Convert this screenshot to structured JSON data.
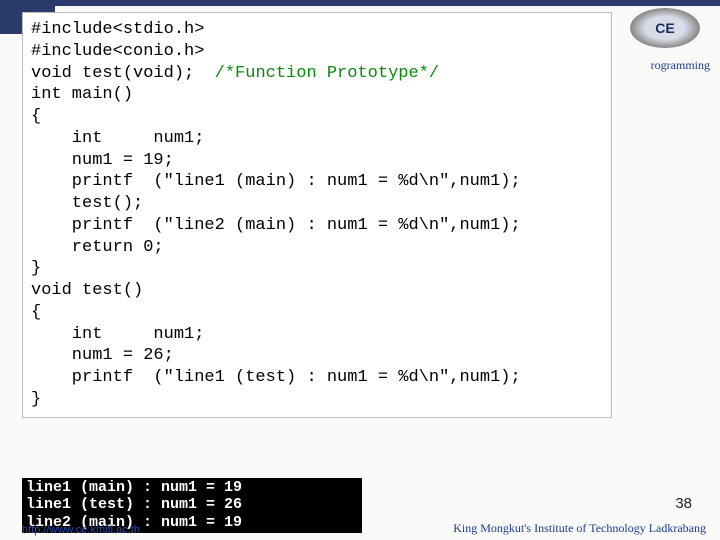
{
  "header": {
    "logo_text": "CE",
    "partial_word": "rogramming"
  },
  "code": {
    "l1": "#include<stdio.h>",
    "l2": "#include<conio.h>",
    "l3a": "void test(void);  ",
    "l3b": "/*Function Prototype*/",
    "l4": "int main()",
    "l5": "{",
    "l6": "    int     num1;",
    "l7": "    num1 = 19;",
    "l8": "    printf  (\"line1 (main) : num1 = %d\\n\",num1);",
    "l9": "    test();",
    "l10": "    printf  (\"line2 (main) : num1 = %d\\n\",num1);",
    "l11": "    return 0;",
    "l12": "}",
    "l13": "void test()",
    "l14": "{",
    "l15": "    int     num1;",
    "l16": "    num1 = 26;",
    "l17": "    printf  (\"line1 (test) : num1 = %d\\n\",num1);",
    "l18": "}"
  },
  "output": {
    "o1": "line1 (main) : num1 = 19",
    "o2": "line1 (test) : num1 = 26",
    "o3": "line2 (main) : num1 = 19"
  },
  "page_number": "38",
  "footer": {
    "url": "http://www.ce.kmitl.ac.th",
    "institution": "King Mongkut's Institute of Technology Ladkrabang"
  }
}
